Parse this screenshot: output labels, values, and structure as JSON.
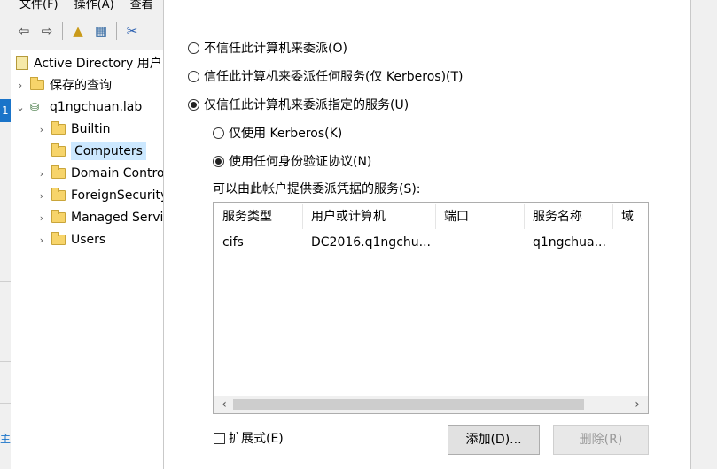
{
  "mmc": {
    "menu": [
      "文件(F)",
      "操作(A)",
      "查看"
    ],
    "strip_number": "1",
    "strip_char": "主",
    "tree": [
      {
        "label": "Active Directory 用户",
        "indent": 0,
        "arrow": "",
        "icon": "book-icon"
      },
      {
        "label": "保存的查询",
        "indent": 1,
        "arrow": "›",
        "icon": "folder-icon"
      },
      {
        "label": "q1ngchuan.lab",
        "indent": 1,
        "arrow": "⌄",
        "icon": "domain-icon"
      },
      {
        "label": "Builtin",
        "indent": 2,
        "arrow": "›",
        "icon": "folder-icon"
      },
      {
        "label": "Computers",
        "indent": 2,
        "arrow": "",
        "icon": "folder-icon",
        "selected": true
      },
      {
        "label": "Domain Controllers",
        "indent": 2,
        "arrow": "›",
        "icon": "folder-icon"
      },
      {
        "label": "ForeignSecurityPrincipals",
        "indent": 2,
        "arrow": "›",
        "icon": "folder-icon"
      },
      {
        "label": "Managed Service Accounts",
        "indent": 2,
        "arrow": "›",
        "icon": "folder-icon"
      },
      {
        "label": "Users",
        "indent": 2,
        "arrow": "›",
        "icon": "folder-icon"
      }
    ]
  },
  "delegation": {
    "opt_none": "不信任此计算机来委派(O)",
    "opt_any": "信任此计算机来委派任何服务(仅 Kerberos)(T)",
    "opt_specified": "仅信任此计算机来委派指定的服务(U)",
    "sub_kerberos": "仅使用 Kerberos(K)",
    "sub_any_protocol": "使用任何身份验证协议(N)",
    "selected": "opt_specified",
    "sub_selected": "sub_any_protocol",
    "services_label": "可以由此帐户提供委派凭据的服务(S):",
    "columns": [
      "服务类型",
      "用户或计算机",
      "端口",
      "服务名称",
      "域"
    ],
    "rows": [
      [
        "cifs",
        "DC2016.q1ngchu...",
        "",
        "q1ngchua...",
        ""
      ]
    ],
    "expanded_label": "扩展式(E)",
    "add_button": "添加(D)...",
    "remove_button": "删除(R)"
  }
}
